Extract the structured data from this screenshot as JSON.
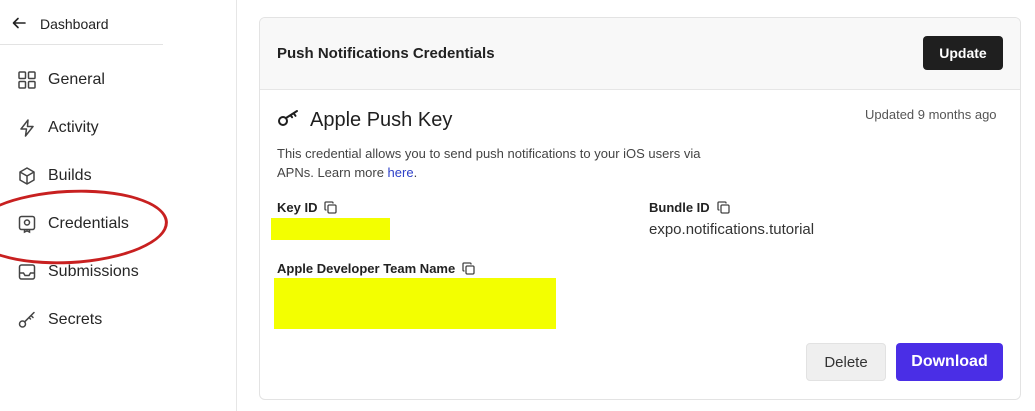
{
  "sidebar": {
    "back_label": "Dashboard",
    "items": [
      {
        "label": "General",
        "icon": "grid-icon"
      },
      {
        "label": "Activity",
        "icon": "lightning-icon"
      },
      {
        "label": "Builds",
        "icon": "cube-icon"
      },
      {
        "label": "Credentials",
        "icon": "credential-badge-icon"
      },
      {
        "label": "Submissions",
        "icon": "submissions-icon"
      },
      {
        "label": "Secrets",
        "icon": "key-icon"
      }
    ],
    "annotation_color": "#c82020"
  },
  "card": {
    "title": "Push Notifications Credentials",
    "update_button": "Update",
    "key_title": "Apple Push Key",
    "updated": "Updated 9 months ago",
    "description_text": "This credential allows you to send push notifications to your iOS users via APNs. Learn more ",
    "description_link": "here",
    "description_end": ".",
    "fields": {
      "key_id_label": "Key ID",
      "bundle_id_label": "Bundle ID",
      "bundle_id_value": "expo.notifications.tutorial",
      "team_name_label": "Apple Developer Team Name"
    },
    "delete_button": "Delete",
    "download_button": "Download"
  },
  "colors": {
    "primary": "#4a2ee6",
    "dark_button": "#1f1f1f",
    "redaction": "#f3ff00"
  }
}
